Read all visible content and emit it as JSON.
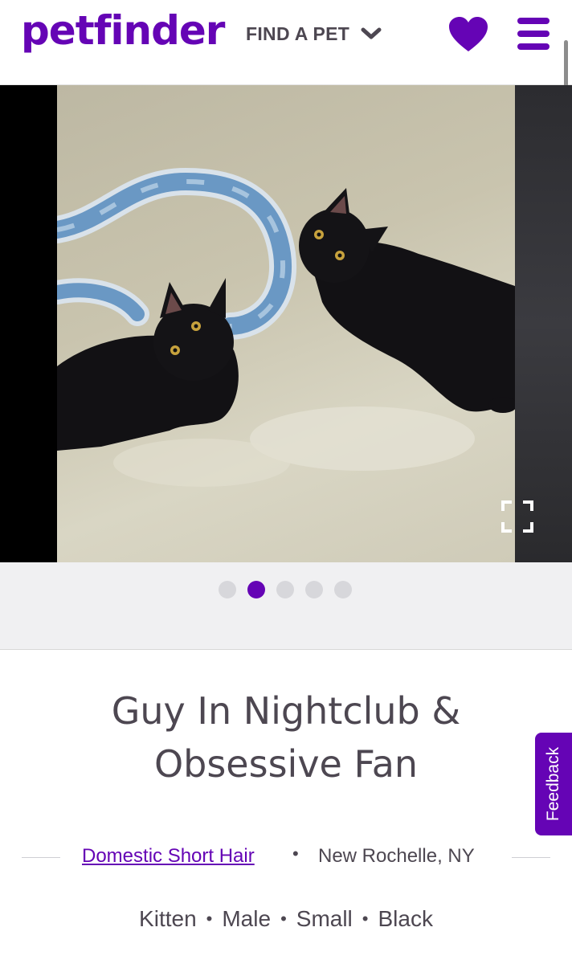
{
  "header": {
    "logo_text": "petfinder",
    "logo_reg": "®",
    "nav_label": "FIND A PET",
    "icons": [
      "chevron-down-icon",
      "heart-icon",
      "hamburger-menu-icon"
    ],
    "brand_color": "#6504b5"
  },
  "gallery": {
    "dots_count": 5,
    "active_dot": 2,
    "icons": [
      "expand-icon"
    ]
  },
  "pet": {
    "name_line1": "Guy In Nightclub &",
    "name_line2": "Obsessive Fan",
    "breed": "Domestic Short Hair",
    "location": "New Rochelle, NY",
    "separator": "•",
    "attributes": [
      "Kitten",
      "Male",
      "Small",
      "Black"
    ]
  },
  "feedback": {
    "label": "Feedback"
  }
}
